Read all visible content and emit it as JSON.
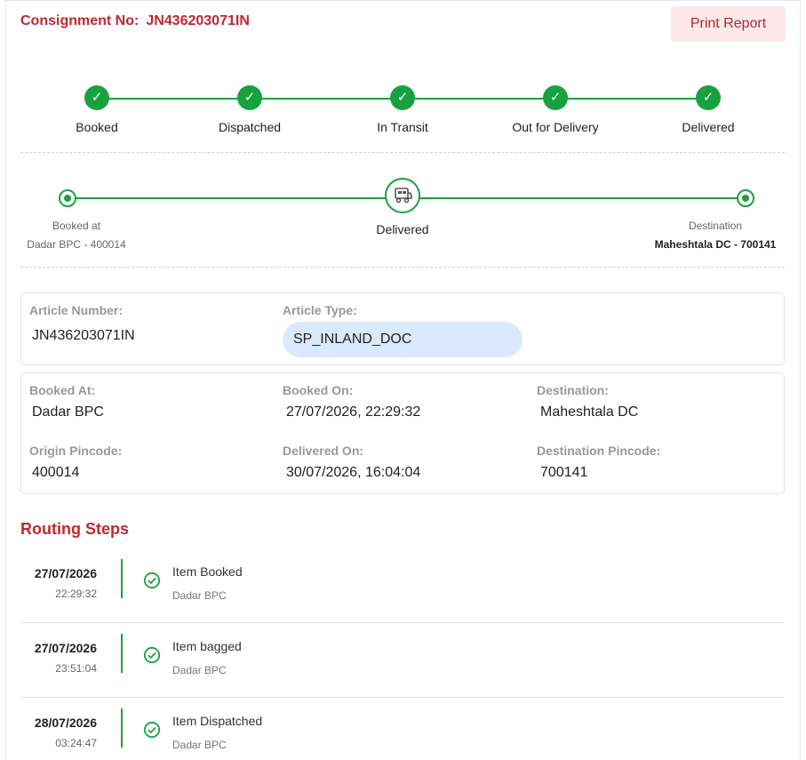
{
  "header": {
    "consignment_label": "Consignment No:",
    "consignment_no": "JN436203071IN",
    "print_button": "Print Report"
  },
  "status_steps": [
    {
      "label": "Booked",
      "done": true
    },
    {
      "label": "Dispatched",
      "done": true
    },
    {
      "label": "In Transit",
      "done": true
    },
    {
      "label": "Out for Delivery",
      "done": true
    },
    {
      "label": "Delivered",
      "done": true
    }
  ],
  "route": {
    "origin_caption": "Booked at",
    "origin_value": "Dadar BPC - 400014",
    "current_status": "Delivered",
    "destination_caption": "Destination",
    "destination_value": "Maheshtala DC - 700141"
  },
  "article": {
    "number_label": "Article Number:",
    "number_value": "JN436203071IN",
    "type_label": "Article Type:",
    "type_value": "SP_INLAND_DOC"
  },
  "details": {
    "booked_at_label": "Booked At:",
    "booked_at_value": "Dadar BPC",
    "booked_on_label": "Booked On:",
    "booked_on_value": "27/07/2026, 22:29:32",
    "destination_label": "Destination:",
    "destination_value": "Maheshtala DC",
    "origin_pin_label": "Origin Pincode:",
    "origin_pin_value": "400014",
    "delivered_on_label": "Delivered On:",
    "delivered_on_value": "30/07/2026, 16:04:04",
    "dest_pin_label": "Destination Pincode:",
    "dest_pin_value": "700141"
  },
  "routing": {
    "title": "Routing Steps",
    "steps": [
      {
        "date": "27/07/2026",
        "time": "22:29:32",
        "event": "Item Booked",
        "office": "Dadar BPC"
      },
      {
        "date": "27/07/2026",
        "time": "23:51:04",
        "event": "Item bagged",
        "office": "Dadar BPC"
      },
      {
        "date": "28/07/2026",
        "time": "03:24:47",
        "event": "Item Dispatched",
        "office": "Dadar BPC"
      }
    ]
  },
  "colors": {
    "brand_red": "#c0282f",
    "success_green": "#18a23f",
    "pill_blue": "#dbe9fc",
    "button_bg": "#fde9ea"
  },
  "icons": {
    "step_done": "check-icon",
    "current_location": "truck-icon",
    "route_step": "check-circle-icon"
  }
}
